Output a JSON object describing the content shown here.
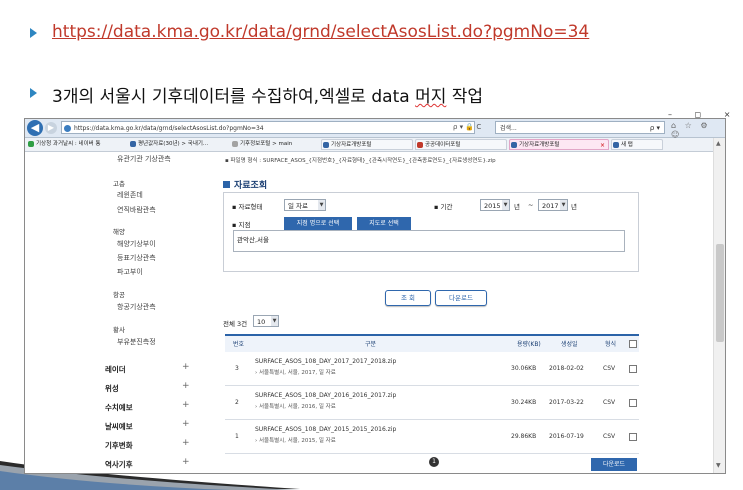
{
  "slide": {
    "line1": "https://data.kma.go.kr/data/grnd/selectAsosList.do?pgmNo=34",
    "line2_prefix": "3개의 서울시 기후데이터를 수집하여,엑셀로 data ",
    "line2_word": "머지",
    "line2_suffix": " 작업"
  },
  "browser": {
    "url": "https://data.kma.go.kr/data/grnd/selectAsosList.do?pgmNo=34",
    "url_icons": "ρ ▾ 🔒 C",
    "search_placeholder": "검색...",
    "search_icon": "ρ ▾",
    "right_icons": "⌂ ☆ ⚙ ☺",
    "window_controls": "– ◻ ×",
    "tabs": [
      {
        "label": "기상청 과거날씨 : 네이버 통",
        "color": "#2f9e44"
      },
      {
        "label": "평년값자료(30년) > 국내기...",
        "color": "#3465a4"
      },
      {
        "label": "기후정보포털 > main",
        "color": "#a3a3a3"
      },
      {
        "label": "기상자료개방포털",
        "color": "#3465a4"
      },
      {
        "label": "공공데이터포털",
        "color": "#c0392b"
      },
      {
        "label": "기상자료개방포털",
        "color": "#3465a4"
      },
      {
        "label": "새 탭",
        "color": "#3465a4"
      }
    ],
    "active_tab_close": "×"
  },
  "sidebar": {
    "items": [
      {
        "label": "유관기관 기상관측",
        "type": "it"
      },
      {
        "label": "고층",
        "type": "sec"
      },
      {
        "label": "레윈존데",
        "type": "it"
      },
      {
        "label": "연직바람관측",
        "type": "it"
      },
      {
        "label": "해양",
        "type": "sec"
      },
      {
        "label": "해양기상부이",
        "type": "it"
      },
      {
        "label": "등표기상관측",
        "type": "it"
      },
      {
        "label": "파고부이",
        "type": "it"
      },
      {
        "label": "항공",
        "type": "sec"
      },
      {
        "label": "항공기상관측",
        "type": "it"
      },
      {
        "label": "황사",
        "type": "sec"
      },
      {
        "label": "부유분진측정",
        "type": "it"
      }
    ],
    "groups": [
      "레이더",
      "위성",
      "수치예보",
      "날씨예보",
      "기후변화",
      "역사기후"
    ],
    "plus": "+"
  },
  "main": {
    "file_format": "▪ 파일명 형식 : SURFACE_ASOS_{지점번호}_{자료형태}_{관측시작연도}_{관측종료연도}_{자료생성연도}.zip",
    "section_title": "자료조회",
    "data_type_label": "▪ 자료형태",
    "data_type_value": "일 자료",
    "period_label": "▪ 기간",
    "start_year": "2015",
    "year_unit": "년",
    "tilde": "~",
    "end_year": "2017",
    "station_label": "▪ 지점",
    "btn_by_name": "지점 명으로 선택",
    "btn_by_map": "지도로 선택",
    "station_value": "관악산,서울",
    "btn_search": "조 회",
    "btn_download": "다운로드",
    "total_count": "전체 3건",
    "page_size": "10",
    "columns": [
      "번호",
      "구분",
      "용량(KB)",
      "생성일",
      "형식"
    ],
    "rows": [
      {
        "no": "3",
        "file": "SURFACE_ASOS_108_DAY_2017_2017_2018.zip",
        "desc": "› 서울특별시, 서울, 2017, 일 자료",
        "size": "30.06KB",
        "date": "2018-02-02",
        "fmt": "CSV"
      },
      {
        "no": "2",
        "file": "SURFACE_ASOS_108_DAY_2016_2016_2017.zip",
        "desc": "› 서울특별시, 서울, 2016, 일 자료",
        "size": "30.24KB",
        "date": "2017-03-22",
        "fmt": "CSV"
      },
      {
        "no": "1",
        "file": "SURFACE_ASOS_108_DAY_2015_2015_2016.zip",
        "desc": "› 서울특별시, 서울, 2015, 일 자료",
        "size": "29.86KB",
        "date": "2016-07-19",
        "fmt": "CSV"
      }
    ],
    "page": "1",
    "bottom_download": "다운로드"
  },
  "colors": {
    "accent": "#2f67ad",
    "link": "#c0392b",
    "bullet": "#2e86c1"
  }
}
